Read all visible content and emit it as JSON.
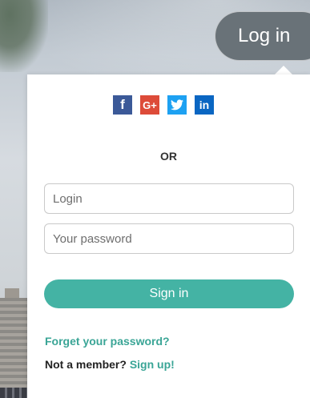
{
  "header": {
    "login_button_label": "Log in"
  },
  "social": {
    "facebook": "f",
    "google": "G+",
    "linkedin": "in"
  },
  "divider": {
    "or_label": "OR"
  },
  "form": {
    "login_placeholder": "Login",
    "password_placeholder": "Your password",
    "signin_label": "Sign in"
  },
  "footer": {
    "forgot_label": "Forget your password?",
    "member_prompt": "Not a member?",
    "signup_label": "Sign up!"
  },
  "colors": {
    "accent": "#44b3a4",
    "facebook": "#3b5998",
    "google": "#dd4b39",
    "twitter": "#1da1f2",
    "linkedin": "#0a66c2"
  }
}
